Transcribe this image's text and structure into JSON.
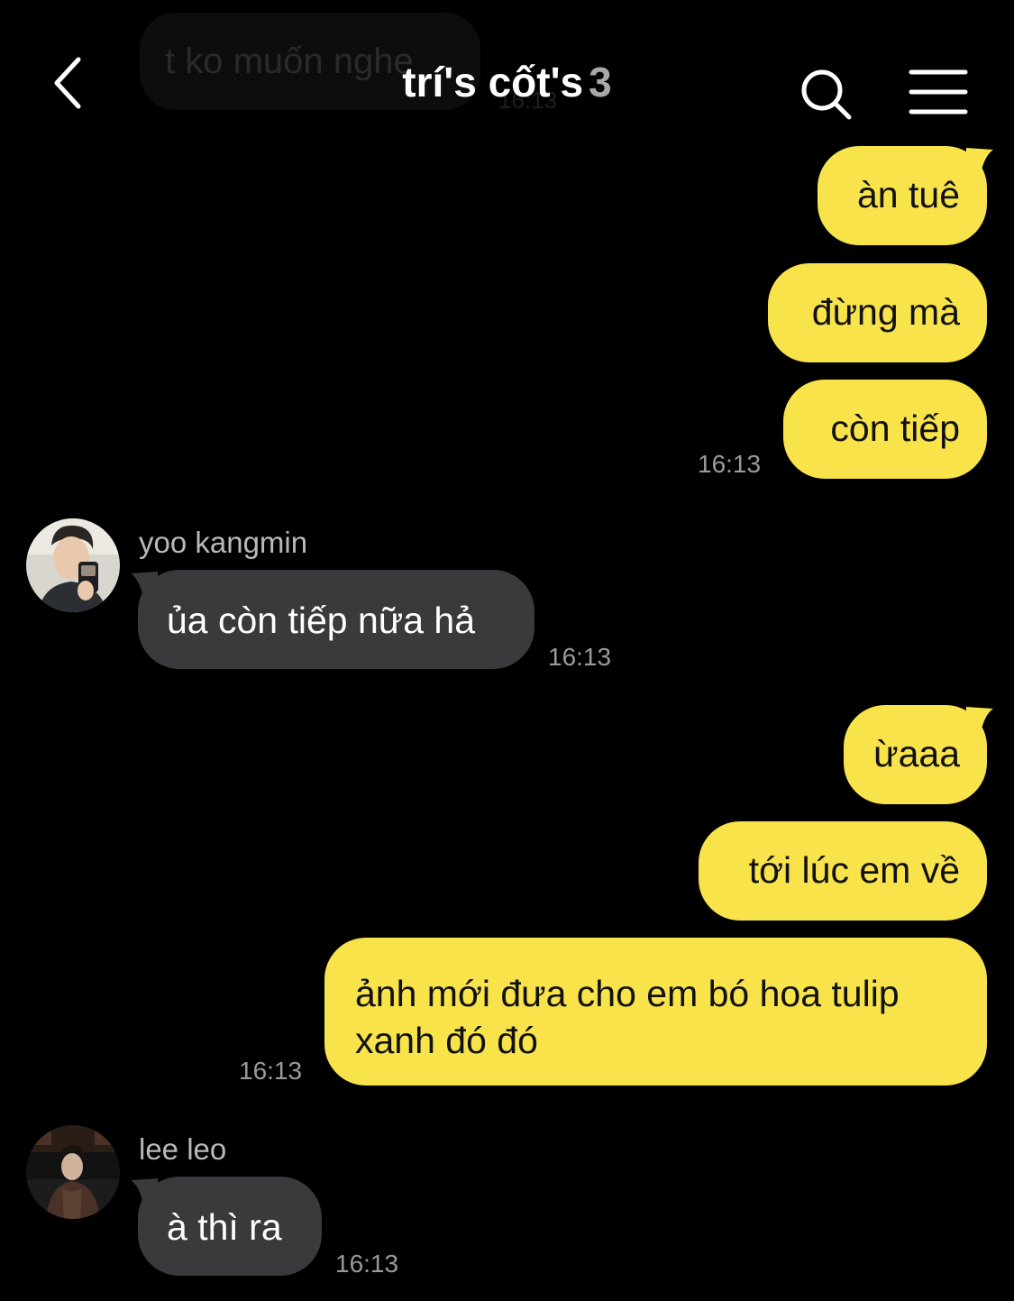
{
  "header": {
    "title": "trí's cốt's",
    "member_count": "3",
    "back_icon": "chevron-left-icon",
    "search_icon": "search-icon",
    "menu_icon": "menu-icon"
  },
  "previous_message": {
    "text": "t ko muốn nghe",
    "time": "16:13"
  },
  "messages": [
    {
      "text": "àn tuê"
    },
    {
      "text": "đừng mà"
    },
    {
      "text": "còn tiếp",
      "time": "16:13"
    },
    {
      "sender": "yoo kangmin",
      "text": "ủa còn tiếp nữa hả",
      "time": "16:13"
    },
    {
      "text": "ừaaa"
    },
    {
      "text": "tới lúc em về"
    },
    {
      "text": "ảnh mới đưa cho em bó hoa tulip xanh đó đó",
      "time": "16:13"
    },
    {
      "sender": "lee leo",
      "text": "à thì ra",
      "time": "16:13"
    }
  ],
  "colors": {
    "background": "#000000",
    "outgoing_bubble": "#f8e34a",
    "incoming_bubble": "#3a3a3c",
    "timestamp": "#9a9a9a"
  }
}
